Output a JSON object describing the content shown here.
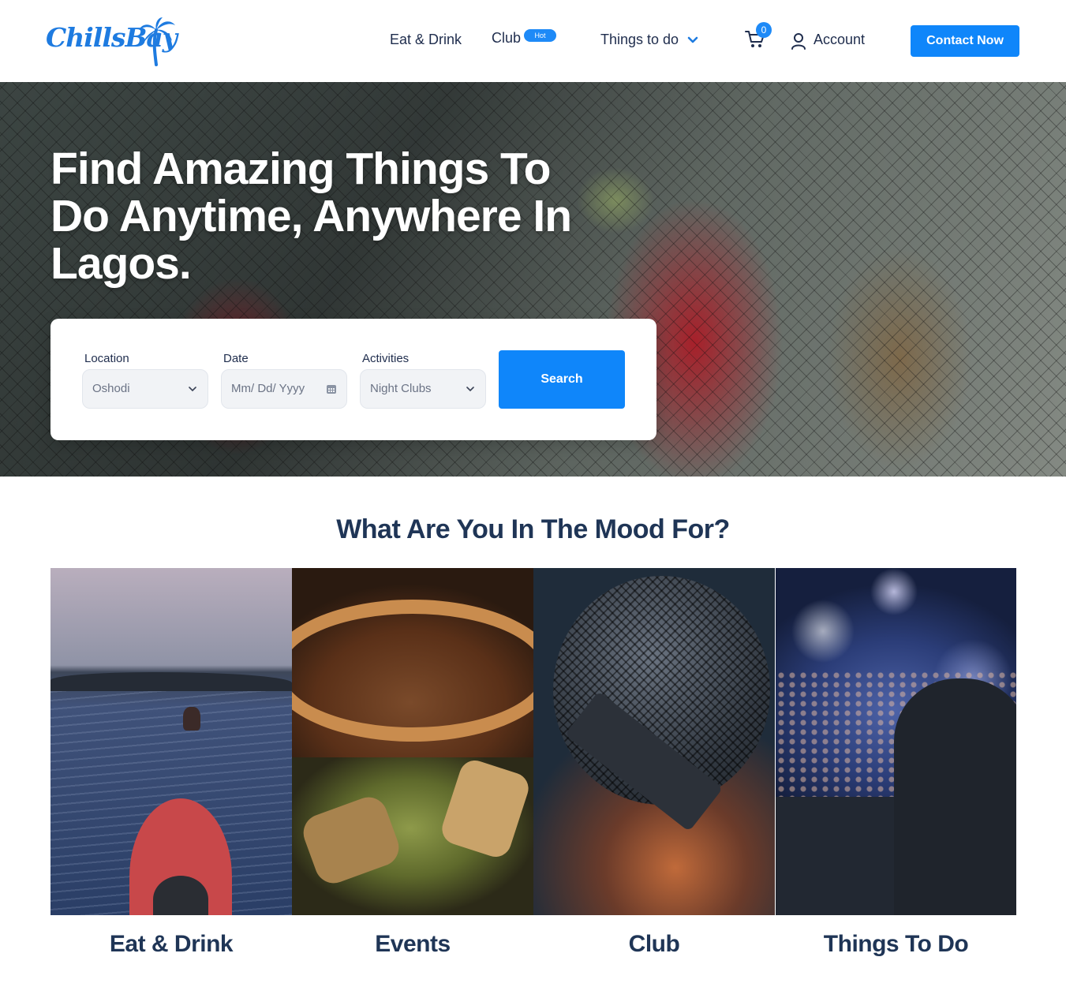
{
  "header": {
    "logo_text": "ChillsBay",
    "nav": {
      "eat_drink": "Eat & Drink",
      "club": "Club",
      "club_badge": "Hot",
      "things_to_do": "Things to do",
      "account": "Account"
    },
    "cart_count": "0",
    "contact_button": "Contact Now",
    "icons": [
      "chevron-down-icon",
      "cart-icon",
      "user-icon",
      "palm-tree-icon"
    ]
  },
  "hero": {
    "title": "Find Amazing Things To Do Anytime, Anywhere In Lagos.",
    "search": {
      "location_label": "Location",
      "location_value": "Oshodi",
      "date_label": "Date",
      "date_placeholder": "Mm/ Dd/ Yyyy",
      "activities_label": "Activities",
      "activities_value": "Night Clubs",
      "search_button": "Search"
    }
  },
  "mood": {
    "title": "What Are You In The Mood For?",
    "cards": [
      {
        "label": "Eat & Drink"
      },
      {
        "label": "Events"
      },
      {
        "label": "Club"
      },
      {
        "label": "Things To Do"
      }
    ]
  },
  "colors": {
    "accent": "#0f86fa",
    "heading": "#1f3556",
    "text": "#1f2d4d"
  }
}
